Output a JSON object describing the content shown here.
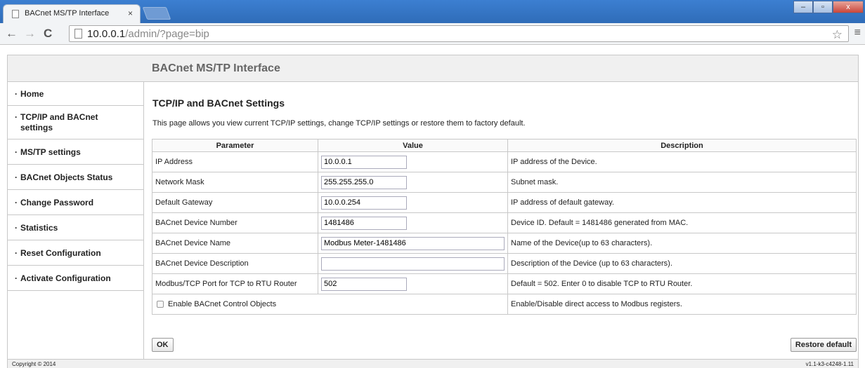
{
  "browser": {
    "tab_title": "BACnet MS/TP Interface",
    "tab_close": "×",
    "url_host": "10.0.0.1",
    "url_path": "/admin/?page=bip",
    "back": "←",
    "forward": "→",
    "reload": "C",
    "star": "☆",
    "menu": "≡",
    "win_minimize": "–",
    "win_maximize": "▫",
    "win_close": "x"
  },
  "header": {
    "title": "BACnet MS/TP Interface"
  },
  "sidebar": {
    "bullet": "·",
    "items": [
      {
        "label": "Home"
      },
      {
        "label": "TCP/IP and BACnet settings"
      },
      {
        "label": "MS/TP settings"
      },
      {
        "label": "BACnet Objects Status"
      },
      {
        "label": "Change Password"
      },
      {
        "label": "Statistics"
      },
      {
        "label": "Reset Configuration"
      },
      {
        "label": "Activate Configuration"
      }
    ]
  },
  "main": {
    "title": "TCP/IP and BACnet Settings",
    "intro": "This page allows you view current TCP/IP settings, change TCP/IP settings or restore them to factory default.",
    "columns": [
      "Parameter",
      "Value",
      "Description"
    ],
    "rows": [
      {
        "param": "IP Address",
        "value": "10.0.0.1",
        "desc": "IP address of the Device."
      },
      {
        "param": "Network Mask",
        "value": "255.255.255.0",
        "desc": "Subnet mask."
      },
      {
        "param": "Default Gateway",
        "value": "10.0.0.254",
        "desc": "IP address of default gateway."
      },
      {
        "param": "BACnet Device Number",
        "value": "1481486",
        "desc": "Device ID. Default = 1481486 generated from MAC."
      },
      {
        "param": "BACnet Device Name",
        "value": "Modbus Meter-1481486",
        "desc": "Name of the Device(up to 63 characters)."
      },
      {
        "param": "BACnet Device Description",
        "value": "",
        "desc": "Description of the Device (up to 63 characters)."
      },
      {
        "param": "Modbus/TCP Port for TCP to RTU Router",
        "value": "502",
        "desc": "Default = 502. Enter 0 to disable TCP to RTU Router."
      }
    ],
    "checkbox_row": {
      "label": "Enable BACnet Control Objects",
      "checked": false,
      "desc": "Enable/Disable direct access to Modbus registers."
    },
    "ok_label": "OK",
    "restore_label": "Restore default"
  },
  "footer": {
    "copyright": "Copyright © 2014",
    "version": "v1.1-k3-c4248-1.11"
  }
}
